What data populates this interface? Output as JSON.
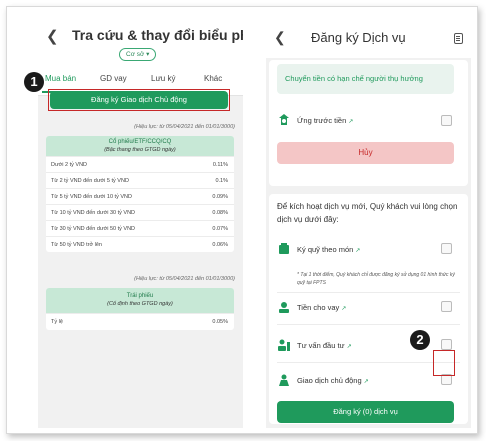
{
  "left": {
    "title": "Tra cứu & thay đổi biểu phí",
    "filter_pill": "Cơ sở ▾",
    "tabs": [
      "Mua bán",
      "GD vay",
      "Lưu ký",
      "Khác"
    ],
    "register_button": "Đăng ký Giao dịch Chủ động",
    "validity_1": "(Hiệu lực: từ 05/04/2021 đến 01/01/3000)",
    "validity_2": "(Hiệu lực: từ 05/04/2021 đến 01/01/3000)",
    "stock_table": {
      "title": "Cổ phiếu/ETF/CCQ/CQ",
      "subtitle": "(Bậc thang theo GTGD ngày)",
      "rows": [
        {
          "label": "Dưới 2 tỷ VND",
          "value": "0.11%"
        },
        {
          "label": "Từ 2 tỷ VND đến dưới 5 tỷ VND",
          "value": "0.1%"
        },
        {
          "label": "Từ 5 tỷ VND đến dưới 10 tỷ VND",
          "value": "0.09%"
        },
        {
          "label": "Từ 10 tỷ VND đến dưới 30 tỷ VND",
          "value": "0.08%"
        },
        {
          "label": "Từ 30 tỷ VND đến dưới 50 tỷ VND",
          "value": "0.07%"
        },
        {
          "label": "Từ 50 tỷ VND trở lên",
          "value": "0.06%"
        }
      ]
    },
    "bond_table": {
      "title": "Trái phiếu",
      "subtitle": "(Cố định theo GTGD ngày)",
      "rows": [
        {
          "label": "Tỷ lệ",
          "value": "0.05%"
        }
      ]
    }
  },
  "right": {
    "title": "Đăng ký Dịch vụ",
    "transfer_button": "Chuyển tiền có hạn chế người thụ hưởng",
    "advance_service": "Ứng trước tiền",
    "cancel_button": "Hủy",
    "intro_text": "Để kích hoạt dịch vụ mới, Quý khách vui lòng chọn dịch vụ dưới đây:",
    "services": [
      "Ký quỹ theo món",
      "Tiền cho vay",
      "Tư vấn đầu tư",
      "Giao dịch chủ động"
    ],
    "note": "* Tại 1 thời điểm, Quý khách chỉ được đăng ký sử dụng 01 hình thức ký quỹ tại FPTS",
    "register_button": "Đăng ký (0) dịch vụ",
    "link_arrow": "↗"
  },
  "badges": [
    "1",
    "2"
  ],
  "colors": {
    "accent": "#1f9a5c",
    "highlight": "#c62828"
  }
}
